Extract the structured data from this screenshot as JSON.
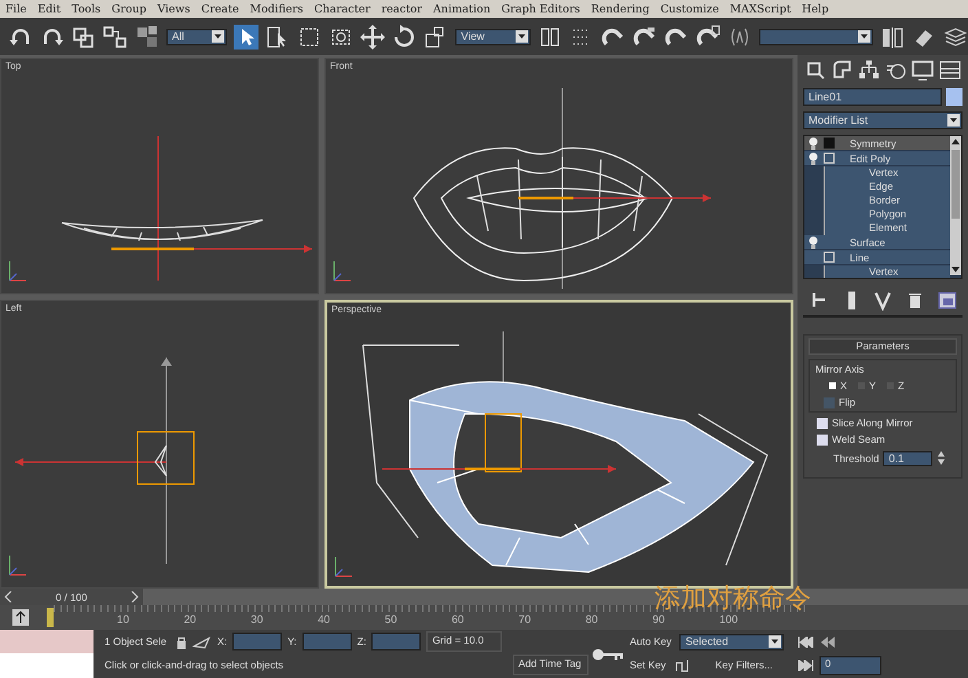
{
  "menu": [
    "File",
    "Edit",
    "Tools",
    "Group",
    "Views",
    "Create",
    "Modifiers",
    "Character",
    "reactor",
    "Animation",
    "Graph Editors",
    "Rendering",
    "Customize",
    "MAXScript",
    "Help"
  ],
  "toolbar": {
    "selection_filter": "All",
    "reference_coordinate": "View"
  },
  "viewports": [
    {
      "label": "Top",
      "active": false,
      "kind": "wireframe"
    },
    {
      "label": "Front",
      "active": false,
      "kind": "wireframe"
    },
    {
      "label": "Left",
      "active": false,
      "kind": "wireframe"
    },
    {
      "label": "Perspective",
      "active": true,
      "kind": "shaded"
    }
  ],
  "command_panel": {
    "object_name": "Line01",
    "modifier_list": "Modifier List",
    "stack": [
      {
        "label": "Symmetry",
        "kind": "modifier",
        "selected": true
      },
      {
        "label": "Edit Poly",
        "kind": "modifier",
        "selected": false,
        "children": [
          {
            "label": "Vertex",
            "selected": false
          },
          {
            "label": "Edge",
            "selected": false
          },
          {
            "label": "Border",
            "selected": false
          },
          {
            "label": "Polygon",
            "selected": false
          },
          {
            "label": "Element",
            "selected": false
          }
        ]
      },
      {
        "label": "Surface",
        "kind": "modifier",
        "selected": false
      },
      {
        "label": "Line",
        "kind": "base",
        "selected": false,
        "children": [
          {
            "label": "Vertex",
            "selected": false
          }
        ]
      }
    ],
    "rollout": {
      "title": "Parameters",
      "group": "Mirror Axis",
      "axes": [
        {
          "label": "X",
          "selected": true
        },
        {
          "label": "Y",
          "selected": false
        },
        {
          "label": "Z",
          "selected": false
        }
      ],
      "flip": {
        "label": "Flip",
        "checked": false
      },
      "options": [
        {
          "label": "Slice Along Mirror",
          "checked": true
        },
        {
          "label": "Weld Seam",
          "checked": true
        }
      ],
      "threshold": {
        "label": "Threshold",
        "value": "0.1"
      }
    }
  },
  "time_slider": {
    "position": "0 / 100",
    "ruler_labels": [
      "10",
      "20",
      "30",
      "40",
      "50",
      "60",
      "70",
      "80",
      "90",
      "100"
    ]
  },
  "status_bar": {
    "selection": "1 Object Sele",
    "x_label": "X:",
    "y_label": "Y:",
    "z_label": "Z:",
    "grid": "Grid = 10.0",
    "prompt": "Click or click-and-drag to select objects",
    "add_time_tag": "Add Time Tag",
    "auto_key": "Auto Key",
    "key_mode": "Selected",
    "set_key": "Set Key",
    "key_filters": "Key Filters...",
    "frame": "0"
  },
  "caption": "添加对称命令"
}
